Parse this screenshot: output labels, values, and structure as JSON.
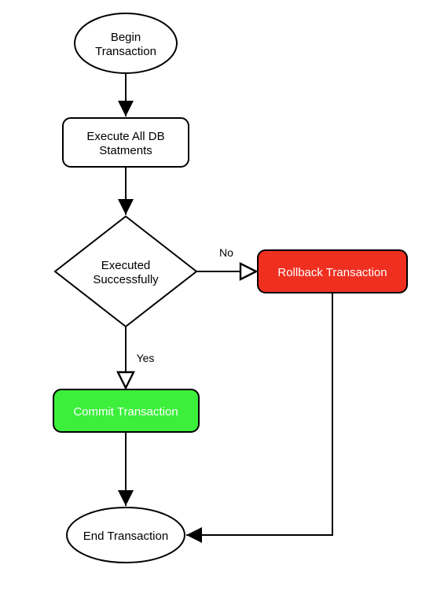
{
  "nodes": {
    "begin": {
      "line1": "Begin",
      "line2": "Transaction"
    },
    "execute": {
      "line1": "Execute All DB",
      "line2": "Statments"
    },
    "decision": {
      "line1": "Executed",
      "line2": "Successfully"
    },
    "rollback": {
      "label": "Rollback Transaction"
    },
    "commit": {
      "label": "Commit Transaction"
    },
    "end": {
      "label": "End Transaction"
    }
  },
  "edges": {
    "no": "No",
    "yes": "Yes"
  },
  "colors": {
    "rollback": "#ef2f20",
    "commit": "#3bef3b",
    "stroke": "#000000"
  }
}
